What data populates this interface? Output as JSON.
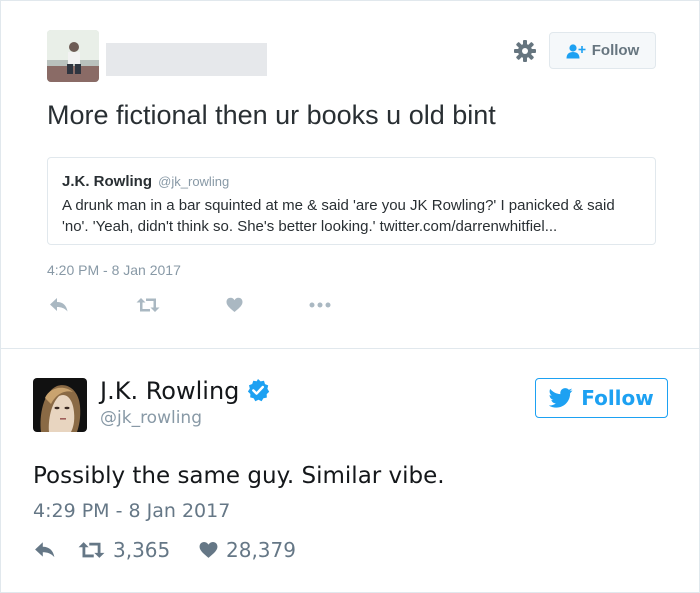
{
  "tweet1": {
    "follow_label": "Follow",
    "text": "More fictional then ur books u old bint",
    "quoted": {
      "name": "J.K. Rowling",
      "handle": "@jk_rowling",
      "text": "A drunk man in a bar squinted at me & said 'are you JK Rowling?' I panicked & said 'no'. 'Yeah, didn't think so. She's better looking.' twitter.com/darrenwhitfiel..."
    },
    "timestamp": "4:20 PM - 8 Jan 2017",
    "actions": [
      "reply-icon",
      "retweet-icon",
      "like-icon",
      "more-icon"
    ]
  },
  "tweet2": {
    "name": "J.K. Rowling",
    "handle": "@jk_rowling",
    "verified": true,
    "follow_label": "Follow",
    "text": "Possibly the same guy. Similar vibe.",
    "timestamp": "4:29 PM - 8 Jan 2017",
    "retweets": "3,365",
    "likes": "28,379"
  },
  "colors": {
    "twitter_blue": "#1da1f2",
    "icon_gray": "#aab8c2",
    "border": "#e1e8ed",
    "secondary_text": "#8899a6"
  }
}
